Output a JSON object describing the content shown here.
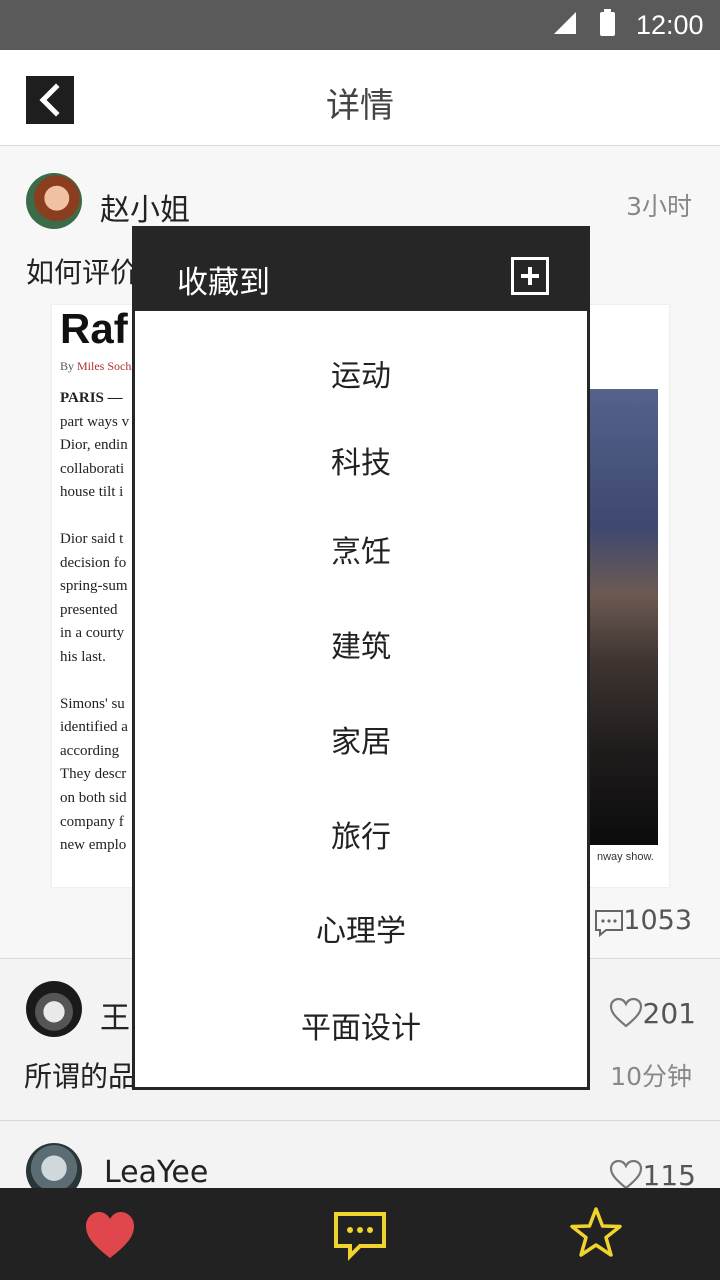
{
  "status_bar": {
    "time": "12:00"
  },
  "header": {
    "title": "详情"
  },
  "post": {
    "username": "赵小姐",
    "time": "3小时",
    "question": "如何评价",
    "image": {
      "headline": "Raf S",
      "byline_prefix": "By",
      "byline_author": "Miles Socha",
      "paragraphs": [
        [
          "PARIS —",
          "part ways v",
          "Dior, endin",
          "collaborati",
          "house tilt i"
        ],
        [
          "Dior said t",
          "decision fo",
          "spring-sum",
          "presented",
          "in a courty",
          "his last."
        ],
        [
          "Simons' su",
          "identified a",
          "according",
          "They descr",
          "on both sid",
          "company f",
          "new emplo"
        ]
      ],
      "caption": "nway show."
    },
    "comments": "1053"
  },
  "list": [
    {
      "username": "王",
      "likes": "201",
      "excerpt": "所谓的品",
      "time": "10分钟"
    },
    {
      "username": "LeaYee",
      "likes": "115"
    }
  ],
  "dialog": {
    "title": "收藏到",
    "options": [
      "运动",
      "科技",
      "烹饪",
      "建筑",
      "家居",
      "旅行",
      "心理学",
      "平面设计"
    ]
  },
  "bottom_bar": {
    "like_icon": "heart-icon",
    "comment_icon": "comment-icon",
    "favorite_icon": "star-icon",
    "like_color": "#e0474c",
    "accent_color": "#f0d32c"
  }
}
